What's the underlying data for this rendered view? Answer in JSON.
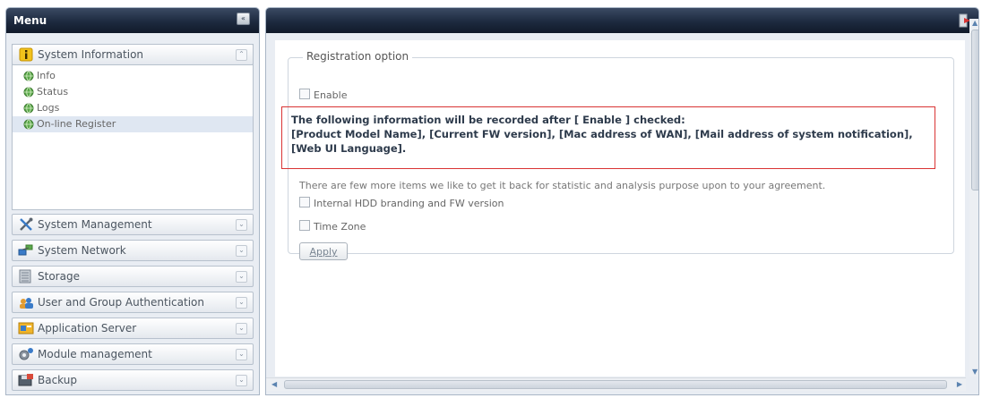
{
  "menu": {
    "title": "Menu",
    "collapse_icon": "collapse-icon",
    "groups": [
      {
        "label": "System Information",
        "icon": "info-icon",
        "expanded": true,
        "items": [
          {
            "label": "Info",
            "icon": "globe-icon"
          },
          {
            "label": "Status",
            "icon": "globe-icon"
          },
          {
            "label": "Logs",
            "icon": "globe-icon"
          },
          {
            "label": "On-line Register",
            "icon": "globe-icon",
            "selected": true
          }
        ]
      },
      {
        "label": "System Management",
        "icon": "tools-icon"
      },
      {
        "label": "System Network",
        "icon": "network-icon"
      },
      {
        "label": "Storage",
        "icon": "storage-icon"
      },
      {
        "label": "User and Group Authentication",
        "icon": "users-icon"
      },
      {
        "label": "Application Server",
        "icon": "app-server-icon"
      },
      {
        "label": "Module management",
        "icon": "module-icon"
      },
      {
        "label": "Backup",
        "icon": "backup-icon"
      }
    ]
  },
  "content": {
    "logout_icon": "logout-icon",
    "section": {
      "legend": "Registration option",
      "enable_label": "Enable",
      "info_lines": [
        "The following information will be recorded after [ Enable ] checked:",
        "[Product Model Name], [Current FW version], [Mac address of WAN], [Mail address of system notification],",
        "[Web UI Language]."
      ],
      "note": "There are few more items we like to get it back for statistic and analysis purpose upon to your agreement.",
      "hdd_label": "Internal HDD branding and FW version",
      "timezone_label": "Time Zone",
      "apply_label": "Apply"
    }
  },
  "colors": {
    "header_dark": "#1d2a3f",
    "highlight_border": "#d93434",
    "panel_bg": "#e9edf3"
  }
}
